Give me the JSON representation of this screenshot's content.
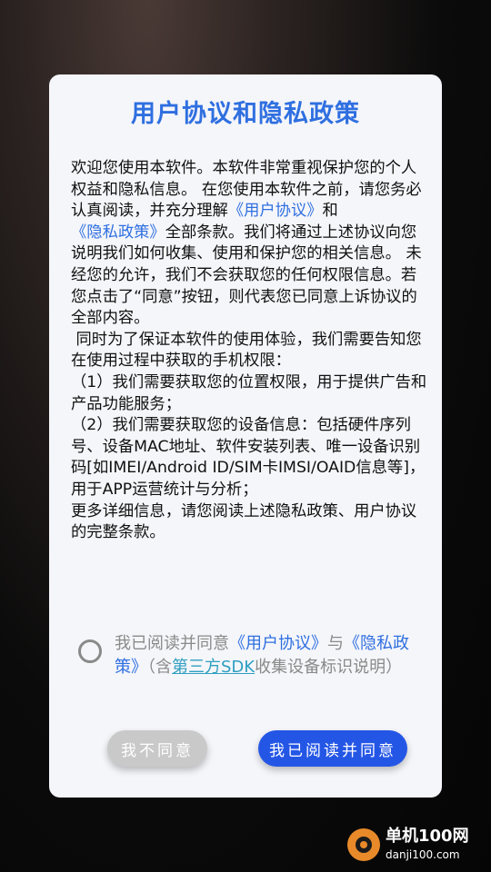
{
  "dialog": {
    "title": "用户协议和隐私政策",
    "body": {
      "p1_a": "欢迎您使用本软件。本软件非常重视保护您的个人权益和隐私信息。 在您使用本软件之前，请您务必认真阅读，并充分理解",
      "link_user": "《用户协议》",
      "p1_and": "和",
      "link_privacy": "《隐私政策》",
      "p1_b": "全部条款。我们将通过上述协议向您说明我们如何收集、使用和保护您的相关信息。 未经您的允许，我们不会获取您的任何权限信息。若您点击了“同意”按钮，则代表您已同意上诉协议的全部内容。",
      "p2": " 同时为了保证本软件的使用体验，我们需要告知您在使用过程中获取的手机权限：",
      "item1": "（1）我们需要获取您的位置权限，用于提供广告和产品功能服务；",
      "item2": "（2）我们需要获取您的设备信息：包括硬件序列号、设备MAC地址、软件安装列表、唯一设备识别码[如IMEI/Android ID/SIM卡IMSI/OAID信息等]，用于APP运营统计与分析；",
      "p3": "更多详细信息，请您阅读上述隐私政策、用户协议的完整条款。"
    },
    "consent": {
      "prefix": "我已阅读并同意",
      "link_user": "《用户协议》",
      "and": "与",
      "link_privacy": "《隐私政策》",
      "paren_open": "（含",
      "link_sdk": "第三方SDK",
      "suffix": "收集设备标识说明）"
    },
    "buttons": {
      "disagree": "我不同意",
      "agree": "我已阅读并同意"
    }
  },
  "watermark": {
    "name": "单机100网",
    "url": "danji100.com"
  },
  "colors": {
    "accent": "#2f6fe0",
    "agree_button": "#2456e6",
    "disagree_button": "#c9c9c9",
    "sdk_link": "#2f9fc0"
  }
}
